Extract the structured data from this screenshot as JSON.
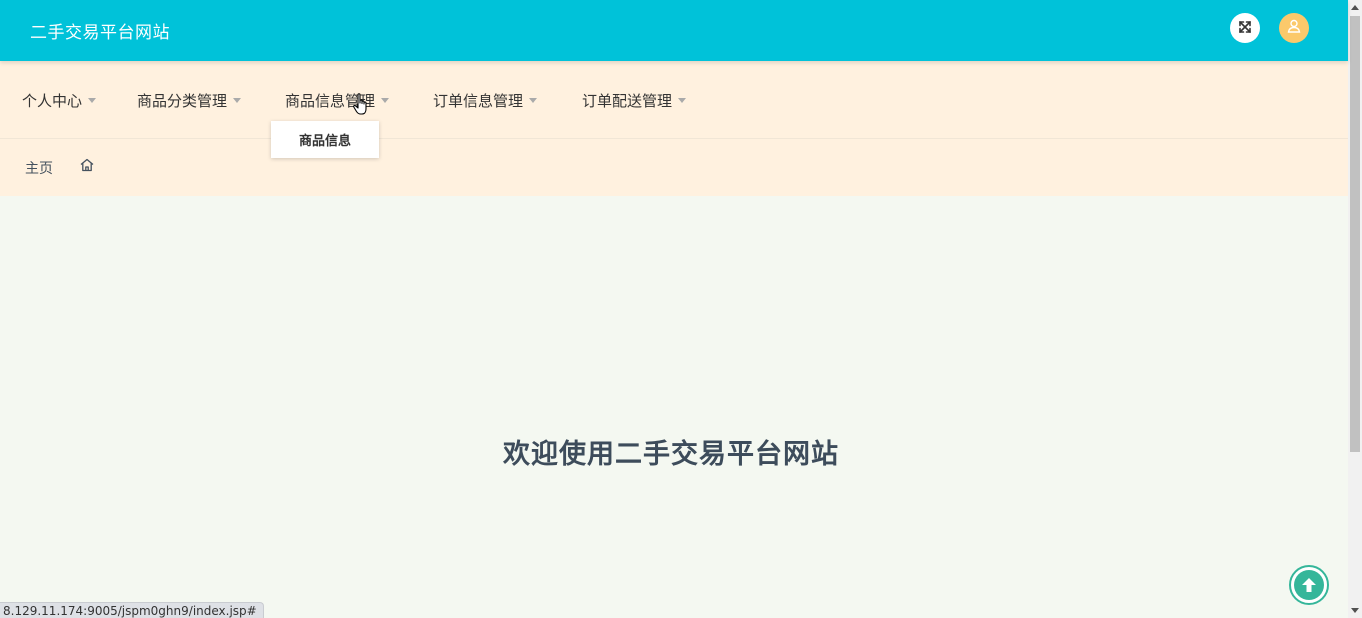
{
  "header": {
    "title": "二手交易平台网站",
    "fullscreen_icon": "expand-arrows-icon",
    "user_icon": "user-icon",
    "colors": {
      "bar": "#00c2d9",
      "avatar": "#fbc96b"
    }
  },
  "nav": {
    "items": [
      {
        "label": "个人中心"
      },
      {
        "label": "商品分类管理"
      },
      {
        "label": "商品信息管理"
      },
      {
        "label": "订单信息管理"
      },
      {
        "label": "订单配送管理"
      }
    ],
    "open_dropdown": {
      "parent": "商品信息管理",
      "items": [
        {
          "label": "商品信息"
        }
      ]
    },
    "background": "#fff1df"
  },
  "breadcrumb": {
    "home_label": "主页",
    "icon": "home-icon"
  },
  "main": {
    "welcome_text": "欢迎使用二手交易平台网站",
    "background": "#f4f8f1"
  },
  "back_to_top": {
    "icon": "arrow-up-circle-icon",
    "color": "#35b69a"
  },
  "status_bar": {
    "url": "8.129.11.174:9005/jspm0ghn9/index.jsp#"
  }
}
